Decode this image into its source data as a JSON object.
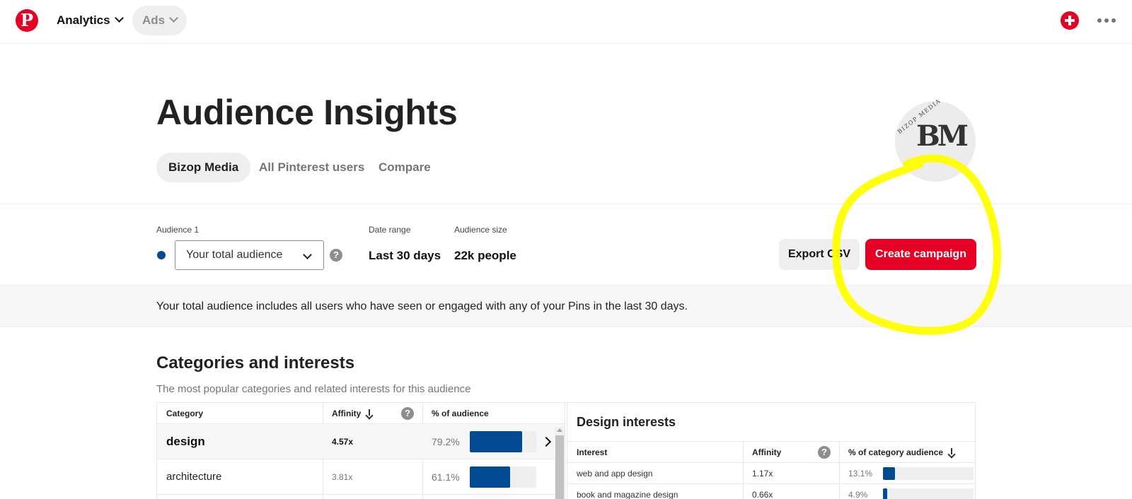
{
  "nav": {
    "logo": "P",
    "analytics_label": "Analytics",
    "ads_label": "Ads"
  },
  "header": {
    "title": "Audience Insights",
    "tabs": [
      {
        "label": "Bizop Media",
        "active": true
      },
      {
        "label": "All Pinterest users",
        "active": false
      },
      {
        "label": "Compare",
        "active": false
      }
    ],
    "avatar": {
      "monogram": "BM",
      "arc_text": "BIZOP MEDIA"
    }
  },
  "filters": {
    "audience_label": "Audience 1",
    "audience_value": "Your total audience",
    "date_range_label": "Date range",
    "date_range_value": "Last 30 days",
    "audience_size_label": "Audience size",
    "audience_size_value": "22k people",
    "help_glyph": "?",
    "audience_color": "#004b91"
  },
  "actions": {
    "export_label": "Export CSV",
    "create_label": "Create campaign"
  },
  "description": "Your total audience includes all users who have seen or engaged with any of your Pins in the last 30 days.",
  "categories": {
    "title": "Categories and interests",
    "subtitle": "The most popular categories and related interests for this audience",
    "headers": {
      "category": "Category",
      "affinity": "Affinity",
      "percent": "% of audience"
    },
    "rows": [
      {
        "name": "design",
        "affinity": "4.57x",
        "percent": "79.2%",
        "fill": 0.792,
        "selected": true
      },
      {
        "name": "architecture",
        "affinity": "3.81x",
        "percent": "61.1%",
        "fill": 0.611,
        "selected": false
      }
    ]
  },
  "interests": {
    "title": "Design interests",
    "headers": {
      "interest": "Interest",
      "affinity": "Affinity",
      "percent": "% of category audience"
    },
    "rows": [
      {
        "name": "web and app design",
        "affinity": "1.17x",
        "percent": "13.1%",
        "fill": 0.131
      },
      {
        "name": "book and magazine design",
        "affinity": "0.66x",
        "percent": "4.9%",
        "fill": 0.049
      }
    ]
  },
  "colors": {
    "brand_red": "#e60023",
    "bar_blue": "#004b91",
    "highlight_yellow": "#ffff00"
  }
}
